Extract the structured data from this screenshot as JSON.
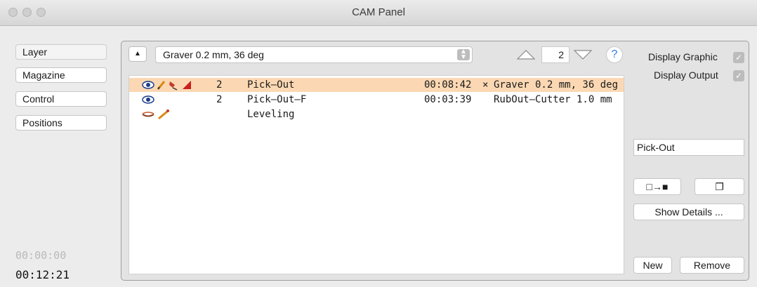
{
  "window": {
    "title": "CAM Panel"
  },
  "sidebar": {
    "items": [
      {
        "label": "Layer"
      },
      {
        "label": "Magazine"
      },
      {
        "label": "Control"
      },
      {
        "label": "Positions"
      }
    ],
    "time_elapsed": "00:00:00",
    "time_total": "00:12:21"
  },
  "toolbar": {
    "tool_select_value": "Graver 0.2 mm, 36 deg",
    "pass_count": "2",
    "help_label": "?"
  },
  "job_list": {
    "rows": [
      {
        "count": "2",
        "name": "Pick–Out",
        "time": "00:08:42",
        "mark": "×",
        "tool": "Graver 0.2 mm, 36 deg",
        "selected": true
      },
      {
        "count": "2",
        "name": "Pick–Out–F",
        "time": "00:03:39",
        "mark": "",
        "tool": "RubOut–Cutter 1.0 mm",
        "selected": false
      },
      {
        "count": "",
        "name": "Leveling",
        "time": "",
        "mark": "",
        "tool": "",
        "selected": false
      }
    ]
  },
  "options": {
    "display_graphic_label": "Display Graphic",
    "display_graphic_checked": true,
    "display_output_label": "Display Output",
    "display_output_checked": true
  },
  "name_field": {
    "value": "Pick-Out"
  },
  "buttons": {
    "transfer_label": "□→■",
    "copy_label": "❐",
    "show_details_label": "Show Details ...",
    "new_label": "New",
    "remove_label": "Remove"
  },
  "colors": {
    "selection": "#fbd8b3",
    "help_accent": "#2a7de1"
  }
}
